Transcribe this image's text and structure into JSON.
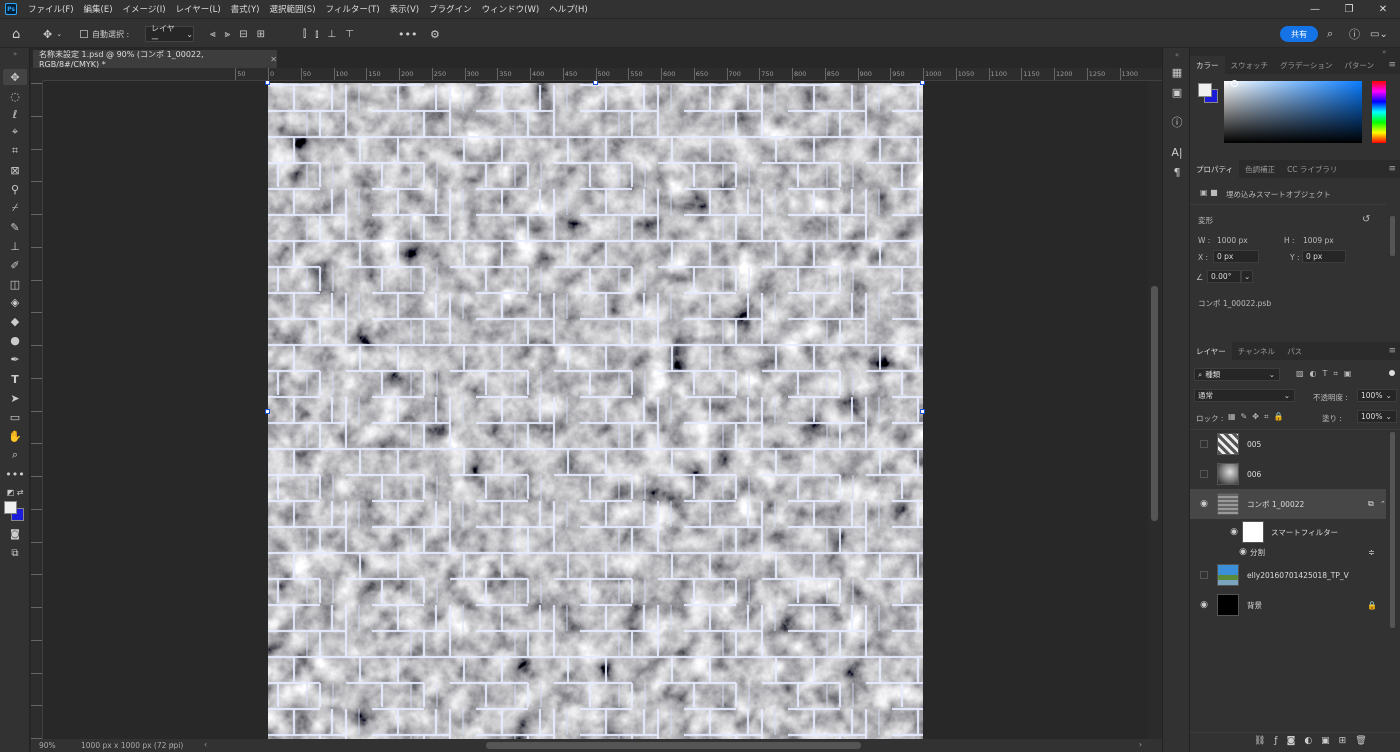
{
  "menubar": {
    "logo": "Ps",
    "items": [
      "ファイル(F)",
      "編集(E)",
      "イメージ(I)",
      "レイヤー(L)",
      "書式(Y)",
      "選択範囲(S)",
      "フィルター(T)",
      "表示(V)",
      "プラグイン",
      "ウィンドウ(W)",
      "ヘルプ(H)"
    ]
  },
  "options": {
    "auto_select_label": "自動選択 :",
    "auto_select_value": "レイヤー",
    "share_label": "共有"
  },
  "document": {
    "tab_title": "名称未設定 1.psd @ 90% (コンポ 1_00022, RGB/8#/CMYK) *",
    "zoom": "90%",
    "size": "1000 px x 1000 px (72 ppi)"
  },
  "ruler_h": [
    "50",
    "0",
    "50",
    "100",
    "150",
    "200",
    "250",
    "300",
    "350",
    "400",
    "450",
    "500",
    "550",
    "600",
    "650",
    "700",
    "750",
    "800",
    "850",
    "900",
    "950",
    "1000",
    "1050",
    "1100",
    "1150",
    "1200",
    "1250",
    "1300"
  ],
  "color_panel": {
    "tabs": [
      "カラー",
      "スウォッチ",
      "グラデーション",
      "パターン"
    ],
    "foreground": "#f0f0f0",
    "background": "#1b1bd8"
  },
  "properties_panel": {
    "tabs": [
      "プロパティ",
      "色調補正",
      "CC ライブラリ"
    ],
    "type_label": "埋め込みスマートオブジェクト",
    "transform_label": "変形",
    "w_label": "W :",
    "w_value": "1000 px",
    "h_label": "H :",
    "h_value": "1009 px",
    "x_label": "X :",
    "x_value": "0 px",
    "y_label": "Y :",
    "y_value": "0 px",
    "angle_value": "0.00°",
    "file_name": "コンポ 1_00022.psb"
  },
  "layers_panel": {
    "tabs": [
      "レイヤー",
      "チャンネル",
      "パス"
    ],
    "filter_value": "種類",
    "blend_mode": "通常",
    "opacity_label": "不透明度 :",
    "opacity_value": "100%",
    "lock_label": "ロック :",
    "fill_label": "塗り :",
    "fill_value": "100%",
    "layers": [
      {
        "name": "005",
        "visible": false
      },
      {
        "name": "006",
        "visible": false
      },
      {
        "name": "コンポ 1_00022",
        "visible": true,
        "selected": true
      },
      {
        "name": "スマートフィルター",
        "visible": true
      },
      {
        "name": "分割",
        "visible": true
      },
      {
        "name": "elly20160701425018_TP_V",
        "visible": false
      },
      {
        "name": "背景",
        "visible": true
      }
    ]
  }
}
